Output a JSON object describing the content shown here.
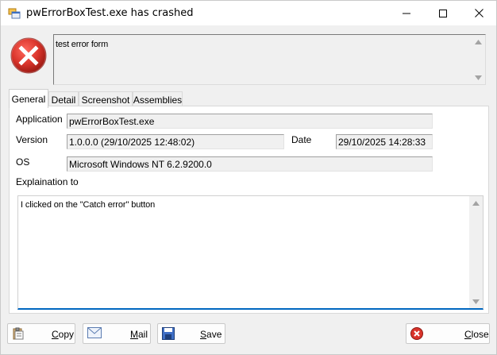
{
  "window": {
    "title": "pwErrorBoxTest.exe has crashed"
  },
  "message": {
    "text": "test error form"
  },
  "tabs": [
    {
      "label": "General",
      "active": true
    },
    {
      "label": "Detail",
      "active": false
    },
    {
      "label": "Screenshot",
      "active": false
    },
    {
      "label": "Assemblies",
      "active": false
    }
  ],
  "general": {
    "application_label": "Application",
    "application_value": "pwErrorBoxTest.exe",
    "version_label": "Version",
    "version_value": "1.0.0.0 (29/10/2025 12:48:02)",
    "date_label": "Date",
    "date_value": "29/10/2025 14:28:33",
    "os_label": "OS",
    "os_value": "Microsoft Windows NT 6.2.9200.0",
    "explanation_label": "Explaination to",
    "explanation_value": "I clicked on the \"Catch error\" button"
  },
  "buttons": {
    "copy_label": "Copy",
    "mail_label": "Mail",
    "save_label": "Save",
    "close_label": "Close"
  },
  "icons": {
    "app": "app-window-icon",
    "error": "error-icon",
    "copy": "clipboard-icon",
    "mail": "envelope-icon",
    "save": "floppy-disk-icon",
    "close": "error-icon"
  },
  "colors": {
    "accent": "#0067c0",
    "error_red": "#d9342b"
  }
}
